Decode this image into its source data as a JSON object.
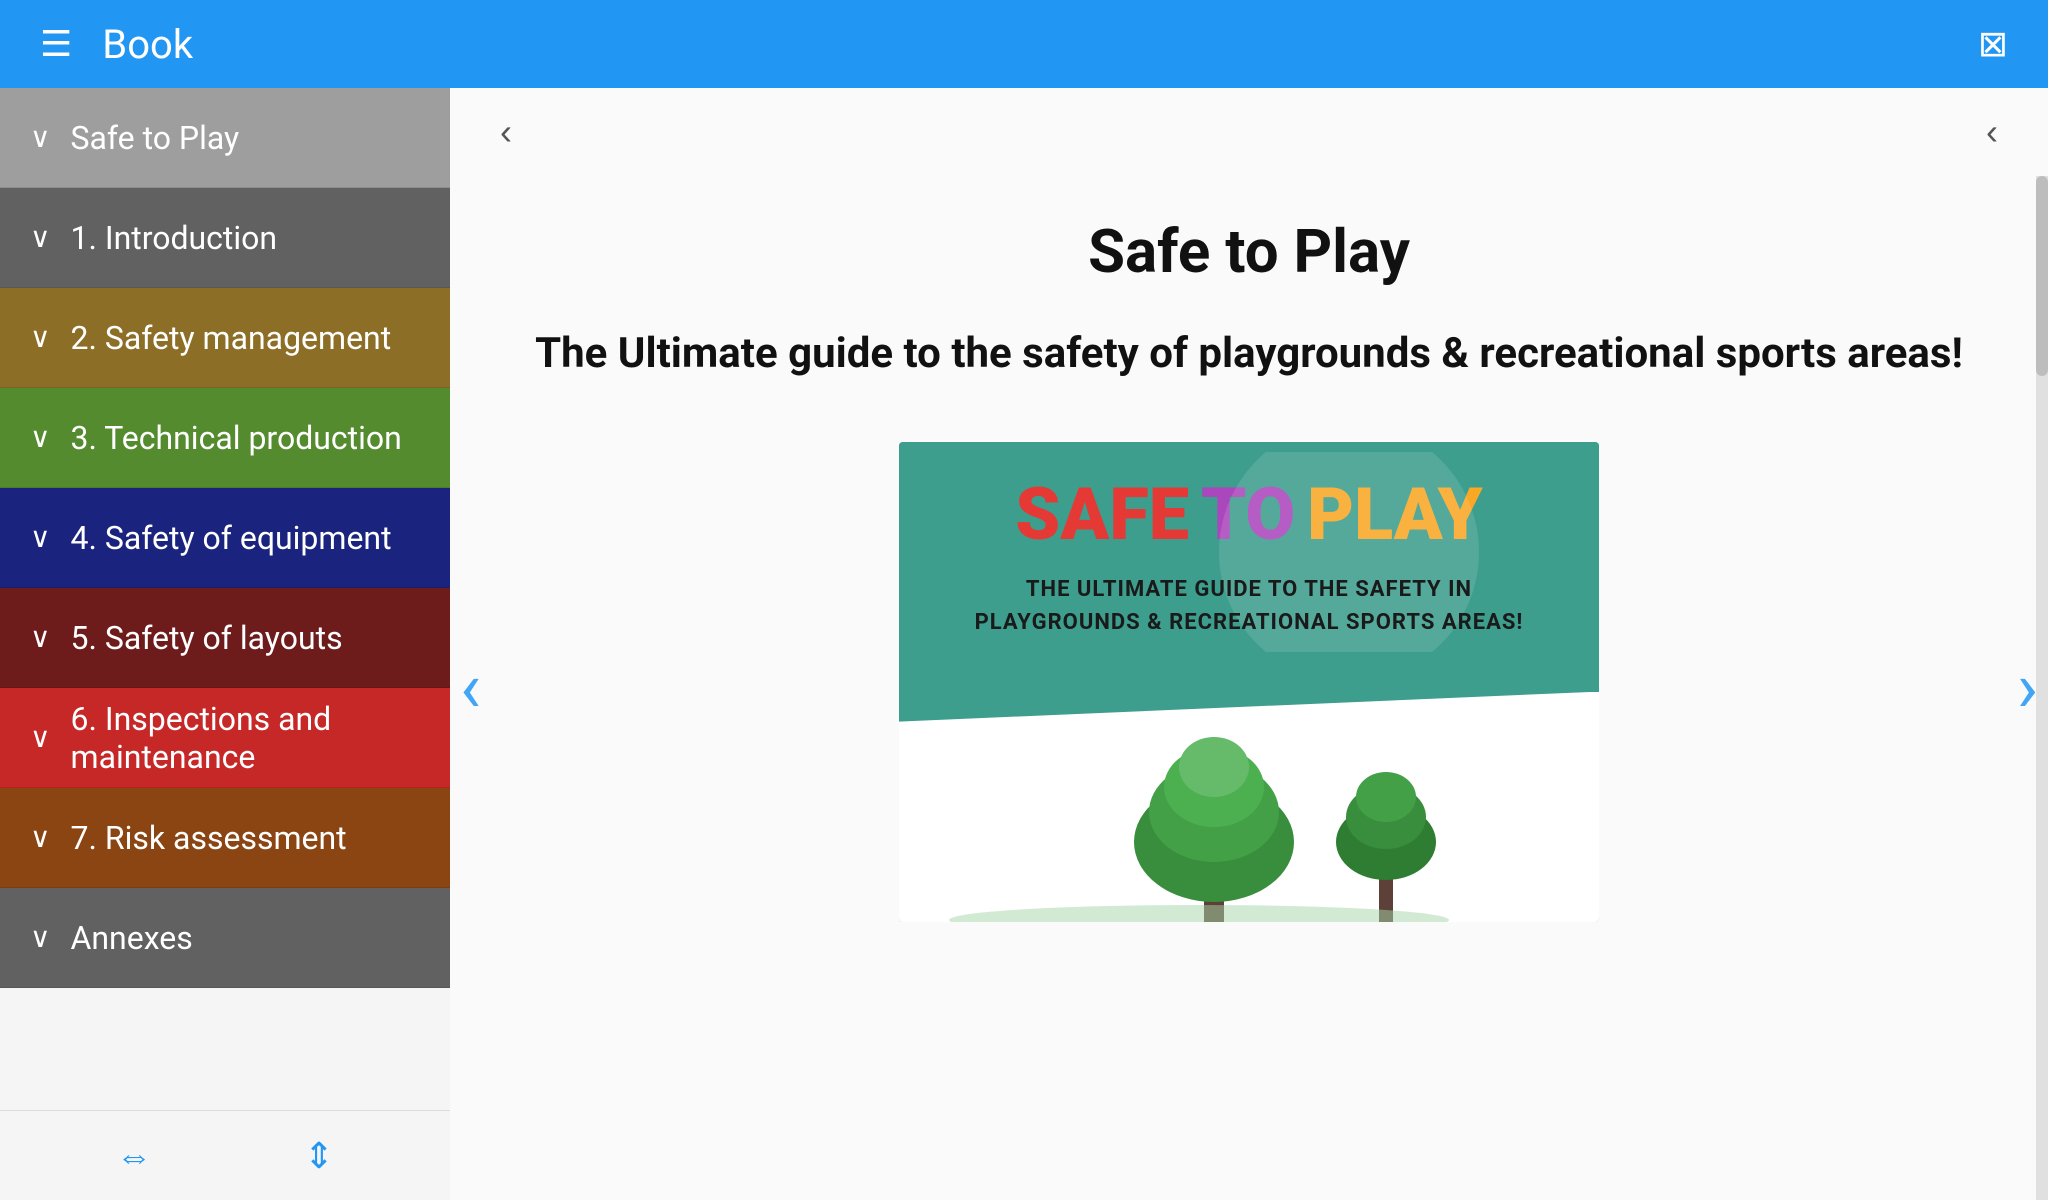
{
  "header": {
    "title": "Book",
    "hamburger": "☰",
    "translate": "⊞"
  },
  "sidebar": {
    "items": [
      {
        "id": "safe-to-play",
        "label": "Safe to Play",
        "chevron": "∨",
        "color": "#9E9E9E"
      },
      {
        "id": "introduction",
        "label": "1. Introduction",
        "chevron": "∨",
        "color": "#616161"
      },
      {
        "id": "safety-management",
        "label": "2. Safety management",
        "chevron": "∨",
        "color": "#8D6E27"
      },
      {
        "id": "technical-production",
        "label": "3. Technical production",
        "chevron": "∨",
        "color": "#558B2F"
      },
      {
        "id": "safety-equipment",
        "label": "4. Safety of equipment",
        "chevron": "∨",
        "color": "#1A237E"
      },
      {
        "id": "safety-layouts",
        "label": "5. Safety of layouts",
        "chevron": "∨",
        "color": "#6D1B1B"
      },
      {
        "id": "inspections",
        "label": "6. Inspections and maintenance",
        "chevron": "∨",
        "color": "#C62828"
      },
      {
        "id": "risk-assessment",
        "label": "7. Risk assessment",
        "chevron": "∨",
        "color": "#8B4513"
      },
      {
        "id": "annexes",
        "label": "Annexes",
        "chevron": "∨",
        "color": "#616161"
      }
    ],
    "footer_icons": [
      "⇕",
      "⇕"
    ]
  },
  "content": {
    "page_title": "Safe to Play",
    "page_subtitle": "The Ultimate guide to the safety of playgrounds & recreational sports areas!",
    "book_cover": {
      "title_safe": "SAFE",
      "title_to": "TO",
      "title_play": "PLAY",
      "subtitle_line1": "THE ULTIMATE GUIDE TO THE SAFETY IN",
      "subtitle_line2": "PLAYGROUNDS & RECREATIONAL SPORTS AREAS!"
    }
  },
  "nav": {
    "left_arrow": "‹",
    "right_arrow": "›",
    "collapse_left": "‹",
    "collapse_right": "‹"
  }
}
